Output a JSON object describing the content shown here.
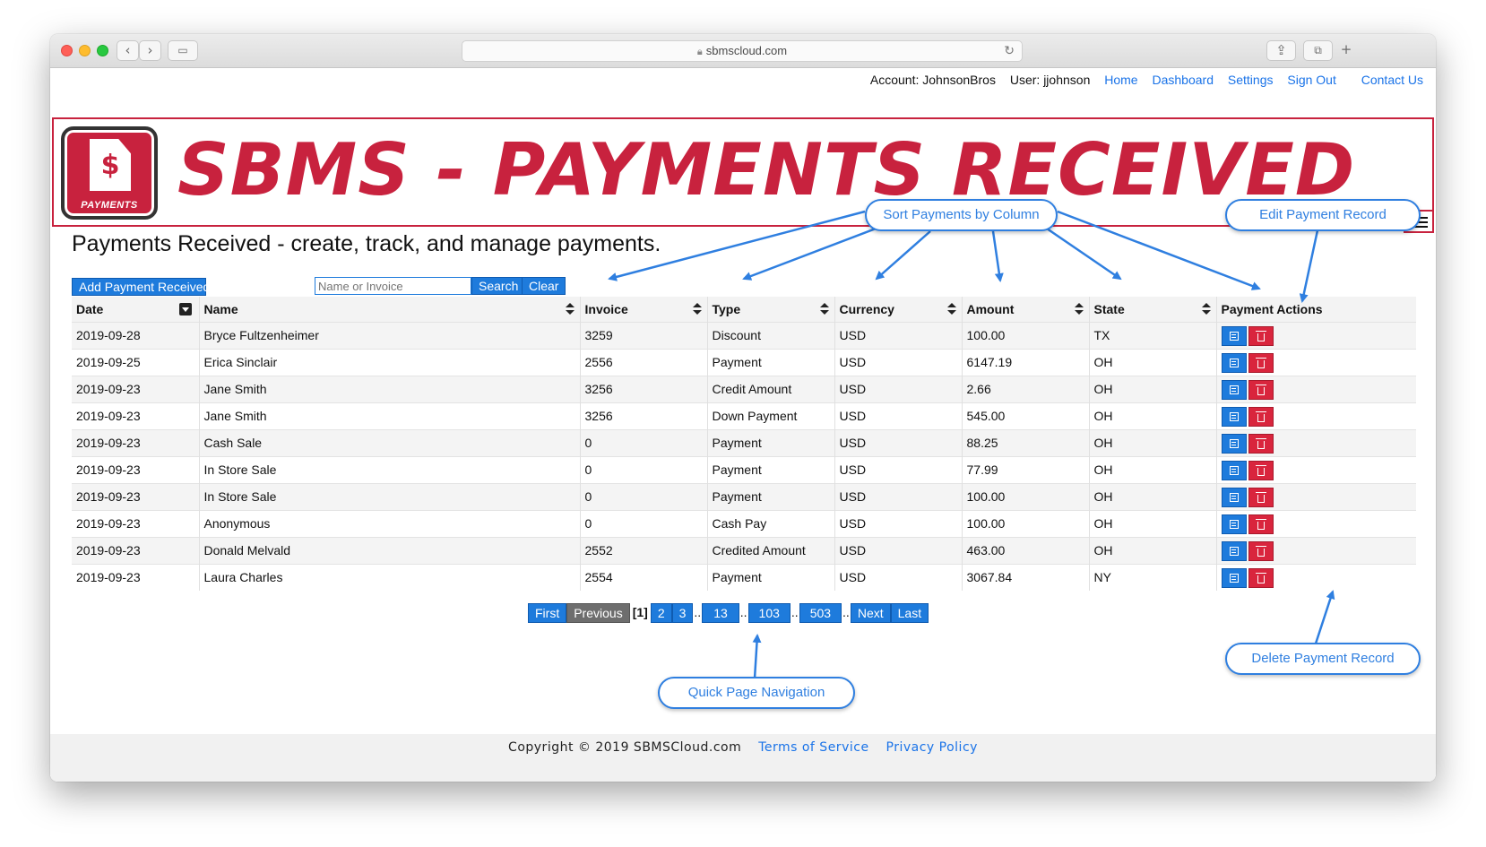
{
  "browser": {
    "url": "sbmscloud.com"
  },
  "topnav": {
    "account": "Account: JohnsonBros",
    "user": "User: jjohnson",
    "links": [
      "Home",
      "Dashboard",
      "Settings",
      "Sign Out",
      "Contact Us"
    ]
  },
  "banner": {
    "title": "SBMS - PAYMENTS RECEIVED",
    "logo_label": "PAYMENTS",
    "logo_symbol": "$"
  },
  "page": {
    "heading": "Payments Received - create, track, and manage payments."
  },
  "toolbar": {
    "add_label": "Add Payment Received",
    "search_placeholder": "Name or Invoice",
    "search_label": "Search",
    "clear_label": "Clear"
  },
  "table": {
    "columns": [
      "Date",
      "Name",
      "Invoice",
      "Type",
      "Currency",
      "Amount",
      "State",
      "Payment Actions"
    ],
    "rows": [
      [
        "2019-09-28",
        "Bryce Fultzenheimer",
        "3259",
        "Discount",
        "USD",
        "100.00",
        "TX"
      ],
      [
        "2019-09-25",
        "Erica Sinclair",
        "2556",
        "Payment",
        "USD",
        "6147.19",
        "OH"
      ],
      [
        "2019-09-23",
        "Jane Smith",
        "3256",
        "Credit Amount",
        "USD",
        "2.66",
        "OH"
      ],
      [
        "2019-09-23",
        "Jane Smith",
        "3256",
        "Down Payment",
        "USD",
        "545.00",
        "OH"
      ],
      [
        "2019-09-23",
        "Cash Sale",
        "0",
        "Payment",
        "USD",
        "88.25",
        "OH"
      ],
      [
        "2019-09-23",
        "In Store Sale",
        "0",
        "Payment",
        "USD",
        "77.99",
        "OH"
      ],
      [
        "2019-09-23",
        "In Store Sale",
        "0",
        "Payment",
        "USD",
        "100.00",
        "OH"
      ],
      [
        "2019-09-23",
        "Anonymous",
        "0",
        "Cash Pay",
        "USD",
        "100.00",
        "OH"
      ],
      [
        "2019-09-23",
        "Donald Melvald",
        "2552",
        "Credited Amount",
        "USD",
        "463.00",
        "OH"
      ],
      [
        "2019-09-23",
        "Laura Charles",
        "2554",
        "Payment",
        "USD",
        "3067.84",
        "NY"
      ]
    ]
  },
  "pagination": {
    "first": "First",
    "previous": "Previous",
    "current": "[1]",
    "pages": [
      "2",
      "3",
      "13",
      "103",
      "503"
    ],
    "next": "Next",
    "last": "Last"
  },
  "footer": {
    "copyright": "Copyright © 2019 SBMSCloud.com",
    "terms": "Terms of Service",
    "privacy": "Privacy Policy"
  },
  "callouts": {
    "sort": "Sort Payments by Column",
    "edit": "Edit Payment Record",
    "delete": "Delete Payment Record",
    "nav": "Quick  Page Navigation"
  },
  "colors": {
    "brand_red": "#c8223e",
    "action_blue": "#1e7bdc",
    "callout_blue": "#2f7fe0"
  },
  "icons": {
    "edit": "edit-icon",
    "delete": "trash-icon",
    "menu": "hamburger-icon"
  }
}
